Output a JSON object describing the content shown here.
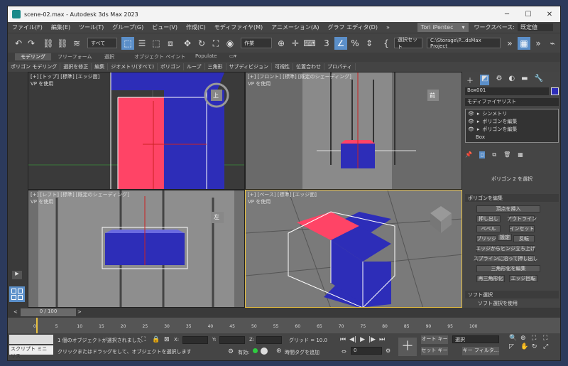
{
  "titlebar": {
    "title": "scene-02.max - Autodesk 3ds Max 2023",
    "minimize": "─",
    "maximize": "☐",
    "close": "✕"
  },
  "menu": [
    "ファイル(F)",
    "編集(E)",
    "ツール(T)",
    "グループ(G)",
    "ビュー(V)",
    "作成(C)",
    "モディファイヤ(M)",
    "アニメーション(A)",
    "グラフ エディタ(D)"
  ],
  "menu_more": "»",
  "user": {
    "name": "Tori iPentec",
    "workspace_label": "ワークスペース:",
    "workspace_value": "既定値"
  },
  "toolbar": {
    "selection_filter": "すべて",
    "named_set": "作業",
    "selection_set_label": "選択セット",
    "project_path": "C:\\Storage\\P...dsMax Project"
  },
  "ribbon_tabs": [
    "モデリング",
    "フリーフォーム",
    "選択",
    "オブジェクト ペイント",
    "Populate"
  ],
  "ribbon_items": [
    "ポリゴン モデリング",
    "選択を修正",
    "編集",
    "ジオメトリ(すべて)",
    "ポリゴン",
    "ループ",
    "三角形",
    "サブディビジョン",
    "可視性",
    "位置合わせ",
    "プロパティ"
  ],
  "viewports": {
    "top": {
      "label": "[+] [トップ] [標準] [エッジ面]",
      "sub": "VP を使用",
      "cube": "上"
    },
    "front": {
      "label": "[+] [フロント] [標準] [既定のシェーディング]",
      "sub": "VP を使用",
      "cube": "前"
    },
    "left": {
      "label": "[+] [レフト] [標準] [既定のシェーディング]",
      "sub": "VP を使用",
      "cube": "左"
    },
    "persp": {
      "label": "[+] [ペース] [標準] [エッジ面]",
      "sub": "VP を使用"
    }
  },
  "cmdpanel": {
    "object_name": "Box001",
    "modifier_list": "モディファイヤリスト",
    "stack": [
      "シンメトリ",
      "ポリゴンを編集",
      "ポリゴンを編集",
      "Box"
    ],
    "subobj_status": "ポリゴン 2 を選択",
    "edit_poly_title": "ポリゴンを編集",
    "insert_vertex": "頂点を挿入",
    "extrude": "押し出し",
    "outline": "アウトライン",
    "bevel": "ベベル",
    "inset": "インセット",
    "bridge": "ブリッジ",
    "settings": "設定",
    "flip": "反転",
    "hinge": "エッジからヒンジ立ち上げ",
    "extrude_spline": "スプラインに沿って押し出し",
    "edit_tri": "三角形化を編集",
    "retriangulate": "再三角形化",
    "turn": "エッジ回転",
    "soft_sel_title": "ソフト選択",
    "use_soft": "ソフト選択を使用"
  },
  "time": {
    "frame": "0 / 100",
    "prev": "<",
    "next": ">",
    "ticks": [
      "0",
      "5",
      "10",
      "15",
      "20",
      "25",
      "30",
      "35",
      "40",
      "45",
      "50",
      "55",
      "60",
      "65",
      "70",
      "75",
      "80",
      "85",
      "90",
      "95",
      "100"
    ]
  },
  "status": {
    "script": "スクリプト ミニ リス",
    "selected": "1 個のオブジェクトが選択されました",
    "hint": "クリックまたはドラッグをして、オブジェクトを選択します",
    "x": "X:",
    "y": "Y:",
    "z": "Z:",
    "grid": "グリッド = 10.0",
    "enabled": "有効:",
    "add_time_tag": "時間タグを追加",
    "frame_value": "0",
    "auto_key": "オート キー",
    "set_key": "セット キー",
    "selection": "選択",
    "key_filters": "キー フィルタ..."
  },
  "colors": {
    "accent": "#5b8fc9",
    "polygon_blue": "#2d2db8",
    "selection_red": "#ff4466",
    "active_border": "#e8c040"
  }
}
